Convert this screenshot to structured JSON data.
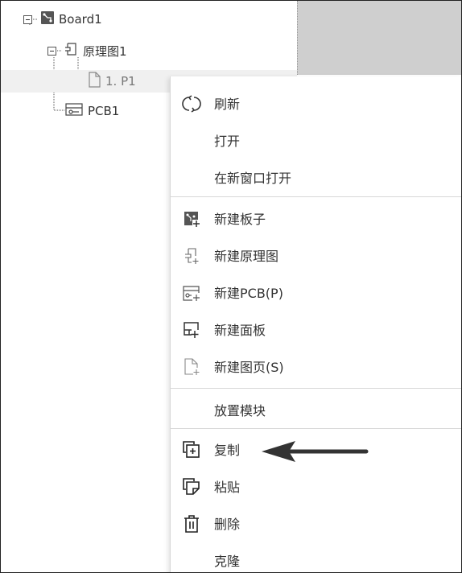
{
  "tree": {
    "board": {
      "label": "Board1"
    },
    "schematic": {
      "label": "原理图1"
    },
    "page": {
      "label": "1. P1"
    },
    "pcb": {
      "label": "PCB1"
    }
  },
  "context_menu": {
    "refresh": "刷新",
    "open": "打开",
    "open_new_window": "在新窗口打开",
    "new_board": "新建板子",
    "new_schematic": "新建原理图",
    "new_pcb": "新建PCB(P)",
    "new_panel": "新建面板",
    "new_page": "新建图页(S)",
    "place_module": "放置模块",
    "copy": "复制",
    "paste": "粘贴",
    "delete": "删除",
    "clone": "克隆"
  },
  "colors": {
    "menu_text": "#333333",
    "arrow": "#333333",
    "board_icon": "#555555"
  }
}
